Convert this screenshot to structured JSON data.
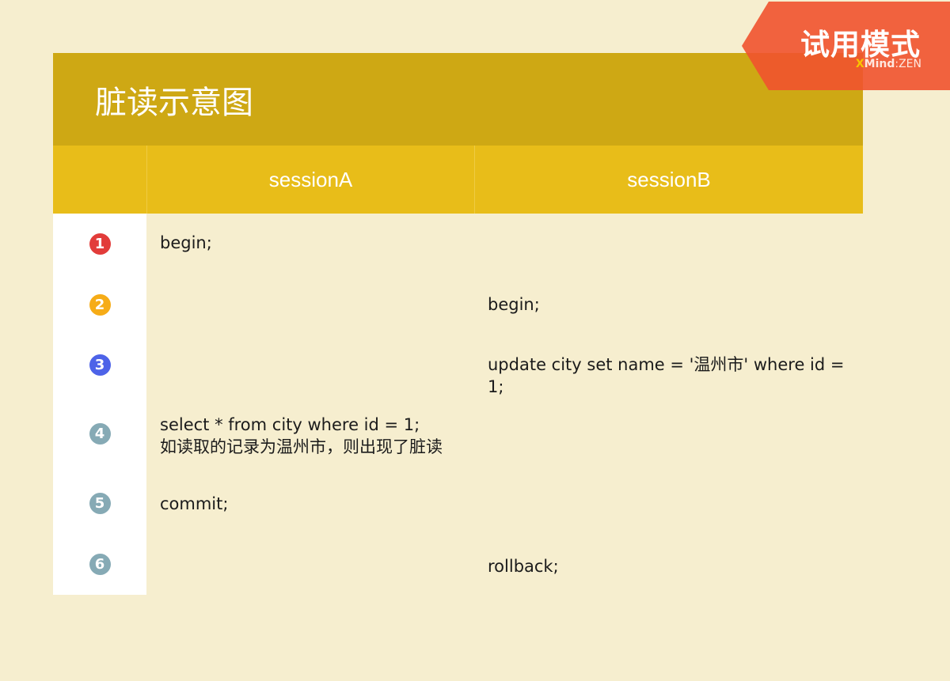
{
  "title": "脏读示意图",
  "columns": {
    "a": "sessionA",
    "b": "sessionB"
  },
  "rows": [
    {
      "step": "1",
      "color": "#e23c3a",
      "a": "begin;",
      "a2": "",
      "b": ""
    },
    {
      "step": "2",
      "color": "#f6ac17",
      "a": "",
      "a2": "",
      "b": "begin;"
    },
    {
      "step": "3",
      "color": "#4d63e8",
      "a": "",
      "a2": "",
      "b": "update city set name = '温州市' where id = 1;"
    },
    {
      "step": "4",
      "color": "#86aab5",
      "a": "select * from city where id = 1;",
      "a2": "如读取的记录为温州市，则出现了脏读",
      "b": ""
    },
    {
      "step": "5",
      "color": "#86aab5",
      "a": "commit;",
      "a2": "",
      "b": ""
    },
    {
      "step": "6",
      "color": "#86aab5",
      "a": "",
      "a2": "",
      "b": "rollback;"
    }
  ],
  "watermark": {
    "text": "试用模式",
    "brand_x": "X",
    "brand_mind": "Mind",
    "brand_sep": ":",
    "brand_zen": "ZEN"
  },
  "colors": {
    "background": "#f6eecf",
    "title_bar": "#cea814",
    "header_bar": "#e8bd19",
    "watermark": "#f1522e"
  }
}
